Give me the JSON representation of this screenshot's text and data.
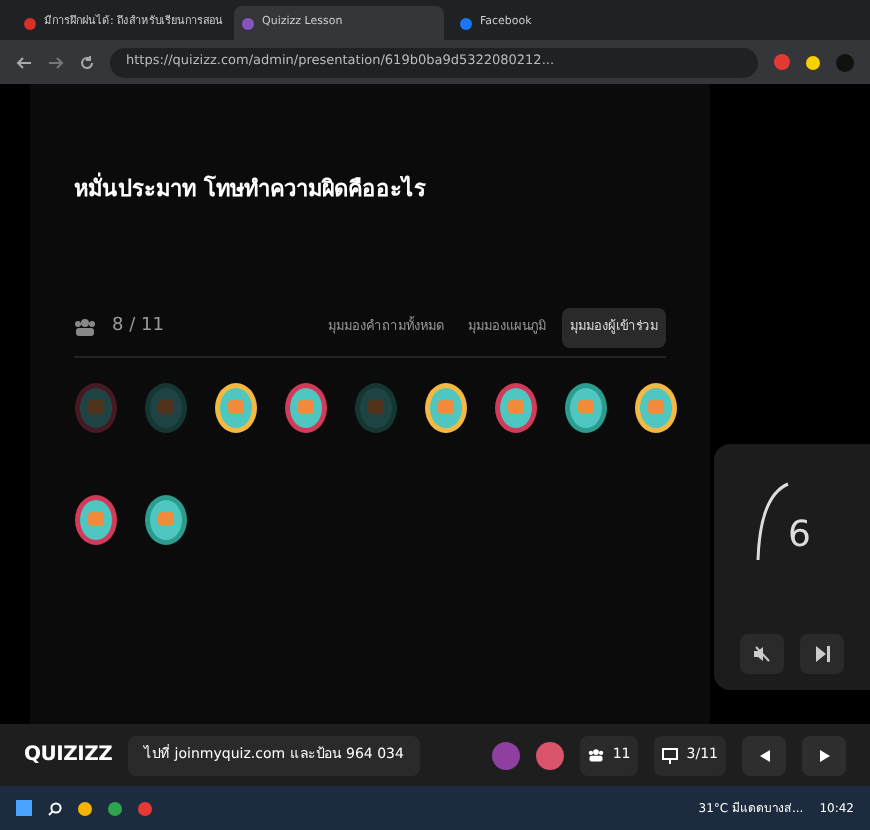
{
  "browser": {
    "tabs": [
      {
        "label": "มีการฝึกฝนได้: ถึงสำหรับเรียนการสอน",
        "selected": false,
        "color": "#d93025"
      },
      {
        "label": "Quizizz Lesson",
        "selected": true,
        "color": "#8854c0"
      },
      {
        "label": "Facebook",
        "selected": false,
        "color": "#1877f2"
      }
    ],
    "url": "https://quizizz.com/admin/presentation/619b0ba9d5322080212..."
  },
  "question": {
    "title": "หมั่นประมาท โทษทำความผิดคืออะไร",
    "count": "8 / 11"
  },
  "views": [
    {
      "label": "มุมมองคำถามทั้งหมด",
      "selected": false
    },
    {
      "label": "มุมมองแผนภูมิ",
      "selected": false
    },
    {
      "label": "มุมมองผู้เข้าร่วม",
      "selected": true
    }
  ],
  "participants": [
    {
      "joined": false
    },
    {
      "joined": false
    },
    {
      "joined": true
    },
    {
      "joined": true
    },
    {
      "joined": false
    },
    {
      "joined": true
    },
    {
      "joined": true
    },
    {
      "joined": true
    },
    {
      "joined": true
    },
    {
      "joined": true
    },
    {
      "joined": true
    }
  ],
  "timer": {
    "value": "6"
  },
  "footer": {
    "logo": "QUIZIZZ",
    "join_text": "ไปที่ joinmyquiz.com และป้อน 964 034",
    "players": "11",
    "slides": "3/11"
  },
  "taskbar": {
    "weather": "31°C มีแดดบางส่...",
    "time": "10:42"
  }
}
